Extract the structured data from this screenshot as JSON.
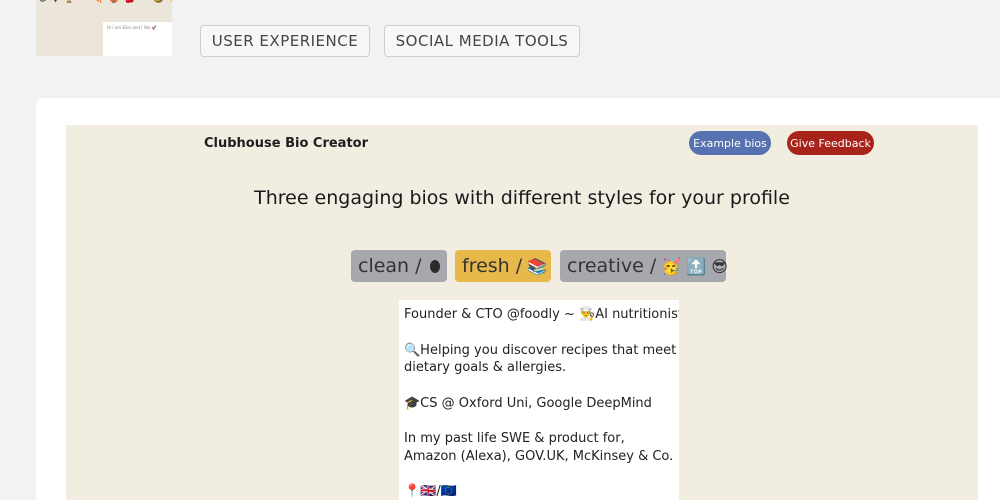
{
  "thumbnail": {
    "emojis": "😄 ♀ 🏆 ⚫ 🍕 🤹 🍒 ❤ 🥝 ✨",
    "card_text": "Hi I am Elon and I like 🚀"
  },
  "tags": {
    "ux": "USER EXPERIENCE",
    "social": "SOCIAL MEDIA TOOLS"
  },
  "app": {
    "title": "Clubhouse Bio Creator",
    "example_bios": "Example bios",
    "give_feedback": "Give Feedback",
    "headline": "Three engaging bios with different styles for your profile",
    "styles": {
      "clean_label": "clean /",
      "fresh_label": "fresh /",
      "fresh_emoji": "📚",
      "creative_label": "creative /",
      "creative_emojis": "🥳 🔝 😎"
    },
    "bio_lines": {
      "l1": "Founder & CTO @foodly ~ 👨‍🍳AI nutritionist",
      "l2": "🔍Helping you discover recipes that meet your",
      "l3": "dietary goals & allergies.",
      "l4": "🎓CS @ Oxford Uni, Google DeepMind",
      "l5": "In my past life SWE & product for,",
      "l6": "Amazon (Alexa), GOV.UK, McKinsey & Co.",
      "l7": "📍🇬🇧/🇪🇺"
    }
  }
}
